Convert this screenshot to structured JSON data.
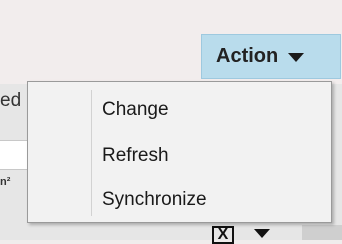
{
  "action_button": {
    "label": "Action",
    "caret_icon": "caret-down-icon"
  },
  "menu": {
    "items": [
      {
        "label": "Change"
      },
      {
        "label": "Refresh"
      },
      {
        "label": "Synchronize"
      }
    ]
  },
  "background": {
    "partial_label": "ed",
    "partial_sup": "n²",
    "clear_icon_glyph": "X"
  },
  "colors": {
    "action_button_bg": "#b9dcec",
    "menu_bg": "#f2f2f2"
  }
}
